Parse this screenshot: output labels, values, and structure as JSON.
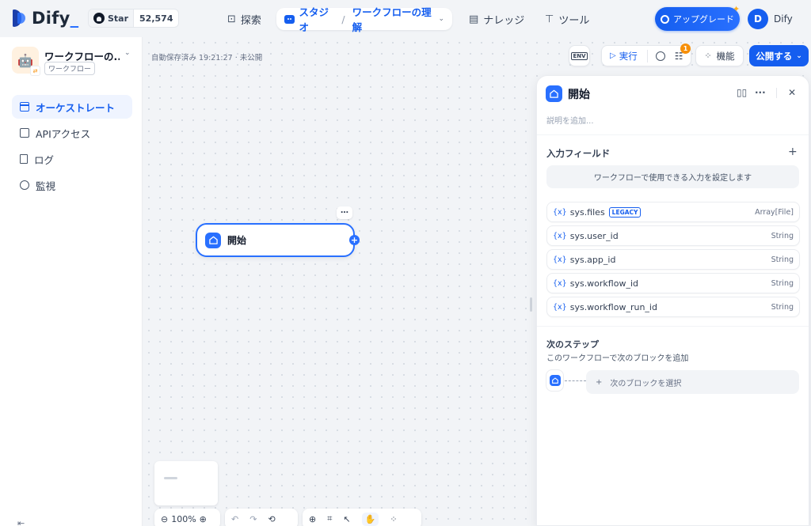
{
  "brand": {
    "name": "Dify",
    "underscore": "_"
  },
  "github": {
    "label": "Star",
    "count": "52,574"
  },
  "nav": {
    "explore": "探索",
    "studio": "スタジオ",
    "current_app": "ワークフローの理解",
    "knowledge": "ナレッジ",
    "tools": "ツール"
  },
  "upgrade_label": "アップグレード",
  "user": {
    "initial": "D",
    "name": "Dify"
  },
  "app": {
    "name": "ワークフローの...",
    "type": "ワークフロー",
    "icon": "robot-emoji"
  },
  "sidebar": {
    "items": [
      {
        "label": "オーケストレート",
        "icon": "orchestrate-icon",
        "active": true
      },
      {
        "label": "APIアクセス",
        "icon": "terminal-icon",
        "active": false
      },
      {
        "label": "ログ",
        "icon": "file-list-icon",
        "active": false
      },
      {
        "label": "監視",
        "icon": "monitor-icon",
        "active": false
      }
    ]
  },
  "toolbar": {
    "autosave": "自動保存済み 19:21:27 · 未公開",
    "env": "ENV",
    "run": "実行",
    "checklist_count": "1",
    "features": "機能",
    "publish": "公開する"
  },
  "canvas": {
    "node_title": "開始",
    "node_more": "…",
    "zoom": "100%"
  },
  "panel": {
    "title": "開始",
    "description_placeholder": "説明を追加...",
    "input_fields_title": "入力フィールド",
    "input_hint": "ワークフローで使用できる入力を設定します",
    "variables": [
      {
        "name": "sys.files",
        "type": "Array[File]",
        "tag": "LEGACY"
      },
      {
        "name": "sys.user_id",
        "type": "String"
      },
      {
        "name": "sys.app_id",
        "type": "String"
      },
      {
        "name": "sys.workflow_id",
        "type": "String"
      },
      {
        "name": "sys.workflow_run_id",
        "type": "String"
      }
    ],
    "var_prefix": "{x}",
    "next_step_title": "次のステップ",
    "next_step_sub": "このワークフローで次のブロックを追加",
    "next_select": "次のブロックを選択"
  },
  "colors": {
    "accent": "#155eef",
    "node_border": "#2970ff",
    "badge": "#f79009"
  }
}
